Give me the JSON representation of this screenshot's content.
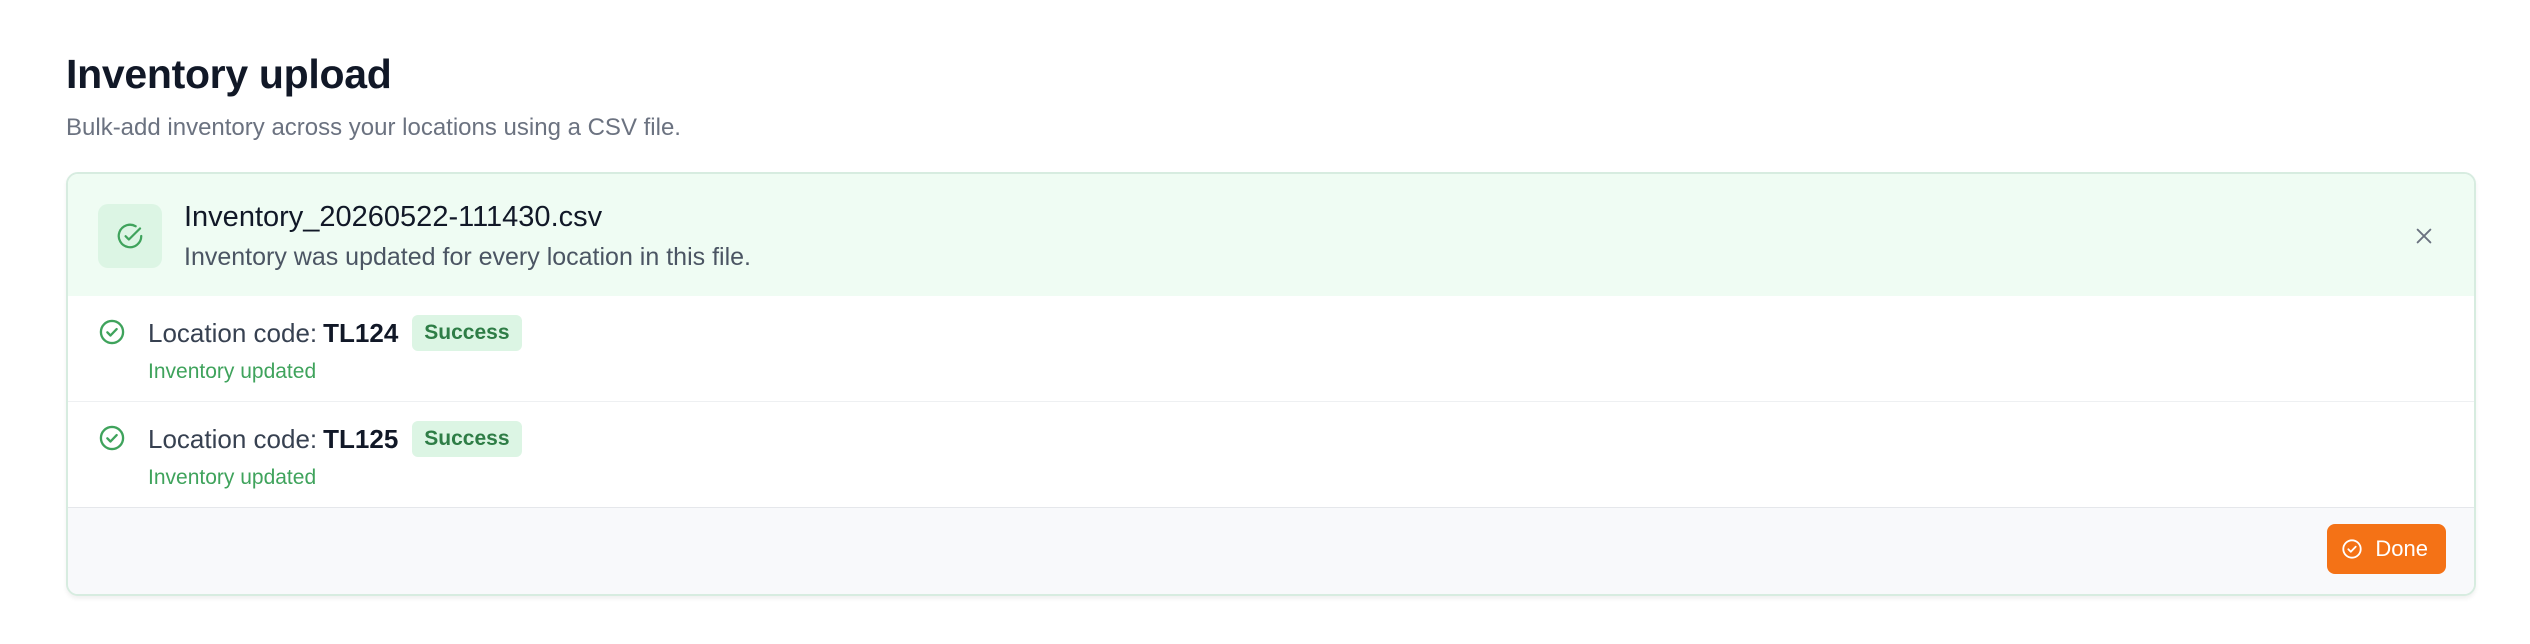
{
  "page": {
    "title": "Inventory upload",
    "subtitle": "Bulk-add inventory across your locations using a CSV file."
  },
  "banner": {
    "file_name": "Inventory_20260522-111430.csv",
    "message": "Inventory was updated for every location in this file.",
    "icon": "check-circle-icon",
    "close_icon": "close-icon"
  },
  "results": [
    {
      "label": "Location code:",
      "code": "TL124",
      "badge": "Success",
      "status": "Inventory updated"
    },
    {
      "label": "Location code:",
      "code": "TL125",
      "badge": "Success",
      "status": "Inventory updated"
    }
  ],
  "footer": {
    "done_label": "Done"
  },
  "colors": {
    "accent": "#f47216",
    "success": "#3fa35c",
    "success_bg": "#effcf3",
    "badge_bg": "#dcf5e4",
    "badge_text": "#2e7d46"
  }
}
